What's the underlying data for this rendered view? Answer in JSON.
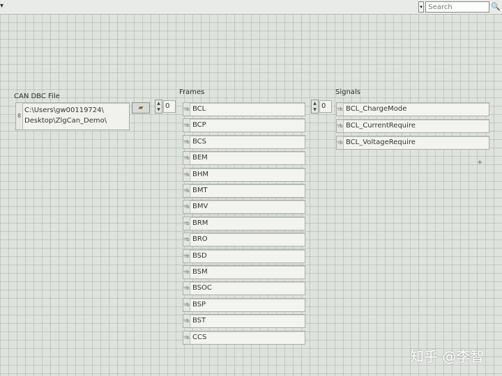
{
  "toolbar": {
    "search_placeholder": "Search",
    "search_icon": "magnifier-icon",
    "menu_icon": "chevron-down-icon"
  },
  "dbc": {
    "label": "CAN DBC File",
    "path_lines": [
      "C:\\Users\\gw00119724\\",
      "Desktop\\ZlgCan_Demo\\"
    ],
    "browse_icon": "folder-icon"
  },
  "frames": {
    "label": "Frames",
    "index": "0",
    "items": [
      "BCL",
      "BCP",
      "BCS",
      "BEM",
      "BHM",
      "BMT",
      "BMV",
      "BRM",
      "BRO",
      "BSD",
      "BSM",
      "BSOC",
      "BSP",
      "BST",
      "CCS"
    ]
  },
  "signals": {
    "label": "Signals",
    "index": "0",
    "items": [
      "BCL_ChargeMode",
      "BCL_CurrentRequire",
      "BCL_VoltageRequire"
    ]
  },
  "watermark": "知乎 @李智",
  "colors": {
    "background": "#dfe3de",
    "control_bg": "#f3f4f0",
    "border": "#a9ada8"
  }
}
